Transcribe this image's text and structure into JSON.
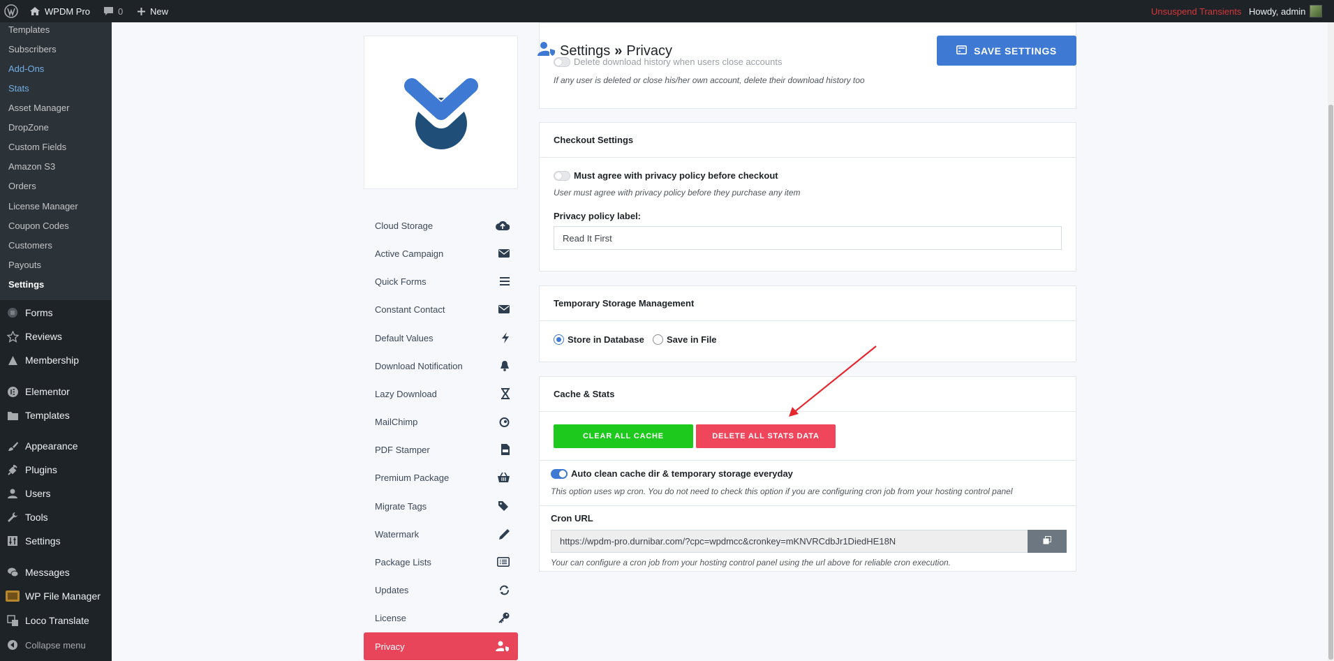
{
  "adminbar": {
    "site_name": "WPDM Pro",
    "comments_count": "0",
    "new_label": "New",
    "unsuspend_label": "Unsuspend Transients",
    "howdy_label": "Howdy, admin"
  },
  "sidebar": {
    "submenu": [
      "Templates",
      "Subscribers",
      "Add-Ons",
      "Stats",
      "Asset Manager",
      "DropZone",
      "Custom Fields",
      "Amazon S3",
      "Orders",
      "License Manager",
      "Coupon Codes",
      "Customers",
      "Payouts",
      "Settings"
    ],
    "menu": [
      "Forms",
      "Reviews",
      "Membership",
      "Elementor",
      "Templates",
      "Appearance",
      "Plugins",
      "Users",
      "Tools",
      "Settings",
      "Messages",
      "WP File Manager",
      "Loco Translate"
    ],
    "collapse_label": "Collapse menu"
  },
  "settings_nav": [
    "Cloud Storage",
    "Active Campaign",
    "Quick Forms",
    "Constant Contact",
    "Default Values",
    "Download Notification",
    "Lazy Download",
    "MailChimp",
    "PDF Stamper",
    "Premium Package",
    "Migrate Tags",
    "Watermark",
    "Package Lists",
    "Updates",
    "License",
    "Privacy"
  ],
  "header": {
    "title": "Settings",
    "separator": "»",
    "section": "Privacy",
    "save_label": "SAVE SETTINGS"
  },
  "download_history": {
    "title": "Delete download history when users close accounts",
    "note": "If any user is deleted or close his/her own account, delete their download history too"
  },
  "checkout": {
    "heading": "Checkout Settings",
    "agree_title": "Must agree with privacy policy before checkout",
    "agree_note": "User must agree with privacy policy before they purchase any item",
    "label_title": "Privacy policy label:",
    "label_value": "Read It First"
  },
  "temp_storage": {
    "heading": "Temporary Storage Management",
    "option_db": "Store in Database",
    "option_file": "Save in File"
  },
  "cache": {
    "heading": "Cache & Stats",
    "clear_label": "CLEAR ALL CACHE",
    "delete_label": "DELETE ALL STATS DATA",
    "auto_title": "Auto clean cache dir & temporary storage everyday",
    "auto_note": "This option uses wp cron. You do not need to check this option if you are configuring cron job from your hosting control panel",
    "cron_title": "Cron URL",
    "cron_url": "https://wpdm-pro.durnibar.com/?cpc=wpdmcc&cronkey=mKNVRCdbJr1DiedHE18N",
    "cron_note": "Your can configure a cron job from your hosting control panel using the url above for reliable cron execution."
  },
  "colors": {
    "accent_blue": "#3e7ad4",
    "active_red": "#e8455a",
    "clear_green": "#1cc91c",
    "delete_red": "#f0465c",
    "adminbar_bg": "#1d2327"
  }
}
